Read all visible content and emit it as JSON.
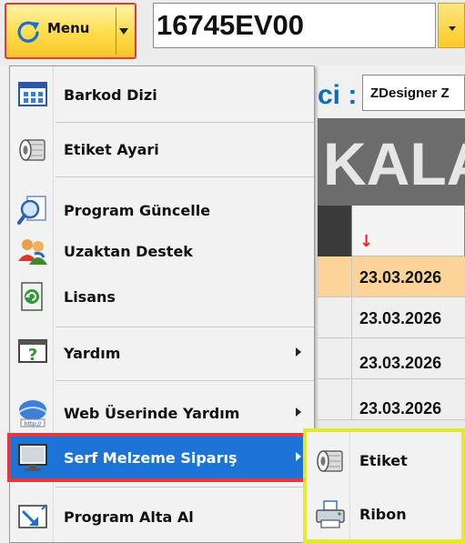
{
  "toolbar": {
    "menu_label": "Menu",
    "code_value": "16745EV00"
  },
  "printer": {
    "label": "ci :",
    "value": "ZDesigner Z"
  },
  "banner": {
    "text": "KALA"
  },
  "grid": {
    "sort_indicator": "↓",
    "dates": [
      "23.03.2026",
      "23.03.2026",
      "23.03.2026",
      "23.03.2026"
    ]
  },
  "menu": {
    "items": [
      {
        "label": "Barkod Dizi",
        "icon": "barcode-grid-icon"
      },
      {
        "label": "Etiket Ayari",
        "icon": "label-roll-icon"
      },
      {
        "label": "Program Güncelle",
        "icon": "magnifier-document-icon"
      },
      {
        "label": "Uzaktan Destek",
        "icon": "users-icon"
      },
      {
        "label": "Lisans",
        "icon": "license-icon"
      },
      {
        "label": "Yardım",
        "icon": "help-icon"
      },
      {
        "label": "Web Üserinde Yardım",
        "icon": "web-help-icon"
      },
      {
        "label": "Serf Melzeme Siparış",
        "icon": "monitor-icon"
      },
      {
        "label": "Program Alta Al",
        "icon": "minimize-icon"
      }
    ]
  },
  "submenu": {
    "items": [
      {
        "label": "Etiket",
        "icon": "label-roll-icon"
      },
      {
        "label": "Ribon",
        "icon": "printer-icon"
      }
    ]
  },
  "colors": {
    "highlight": "#1e74d6",
    "annotation_red": "#e4383d",
    "annotation_yellow": "#e4ea2a",
    "menu_button": "#ffdc4a"
  }
}
